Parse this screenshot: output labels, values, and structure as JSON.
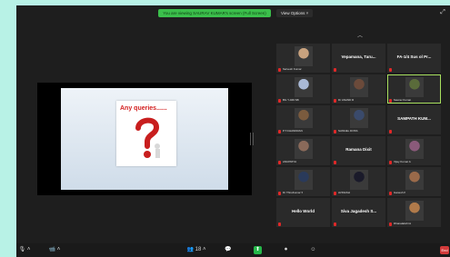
{
  "banner": {
    "text": "You are viewing SAURAV KUMAR's screen (Full Screen)"
  },
  "header": {
    "view_options": "View Options ˅"
  },
  "slide": {
    "title": "Any queries......"
  },
  "gallery": {
    "tiles": [
      {
        "name": "",
        "caption": "Sarvesh Kumar",
        "kind": "photo",
        "color": "#c8a27e"
      },
      {
        "name": "Vepamana, Taru...",
        "caption": "",
        "kind": "name"
      },
      {
        "name": "FA-1/4 Sus ol Pr...",
        "caption": "",
        "kind": "name"
      },
      {
        "name": "",
        "caption": "BG Y-049 SB",
        "kind": "photo",
        "color": "#a9b9d6"
      },
      {
        "name": "",
        "caption": "Dr ANAND R",
        "kind": "photo",
        "color": "#6b4a3a"
      },
      {
        "name": "",
        "caption": "Saurav Kumar",
        "kind": "photo",
        "color": "#5a6b3a",
        "active": true
      },
      {
        "name": "",
        "caption": "P.T.CHANDRAN",
        "kind": "photo",
        "color": "#7a5b3e"
      },
      {
        "name": "",
        "caption": "SAMUEL DOSS",
        "kind": "photo",
        "color": "#3a4a6b"
      },
      {
        "name": "SAMPATH KUM...",
        "caption": "",
        "kind": "name"
      },
      {
        "name": "",
        "caption": "ANUPRIYA",
        "kind": "photo",
        "color": "#8a6a5a"
      },
      {
        "name": "Ramana Dixit",
        "caption": "",
        "kind": "name"
      },
      {
        "name": "",
        "caption": "Vijay Kumar A",
        "kind": "photo",
        "color": "#8a5a7a"
      },
      {
        "name": "",
        "caption": "Dr ThiruKumar S",
        "kind": "photo",
        "color": "#2a3a5a"
      },
      {
        "name": "",
        "caption": "AVINASH",
        "kind": "photo",
        "color": "#1a1a2a"
      },
      {
        "name": "",
        "caption": "Ganesh P",
        "kind": "photo",
        "color": "#9a6a4a"
      },
      {
        "name": "Hello World",
        "caption": "",
        "kind": "name"
      },
      {
        "name": "Siva Jagadesh S...",
        "caption": "",
        "kind": "name"
      },
      {
        "name": "",
        "caption": "Dhanalakshmi",
        "kind": "photo",
        "color": "#b07a4a"
      }
    ]
  },
  "toolbar": {
    "mic": "🎙 ˄",
    "video": "📹 ˄",
    "participants": "👥 18 ˄",
    "chat": "💬",
    "share": "⬆",
    "record": "⏺",
    "reactions": "☺",
    "end": "End"
  },
  "colors": {
    "background": "#1e1e1e",
    "banner": "#3bbf4b",
    "active_speaker": "#a8e05f",
    "mic_off": "#e02828",
    "page_border": "#b8f2e6"
  }
}
